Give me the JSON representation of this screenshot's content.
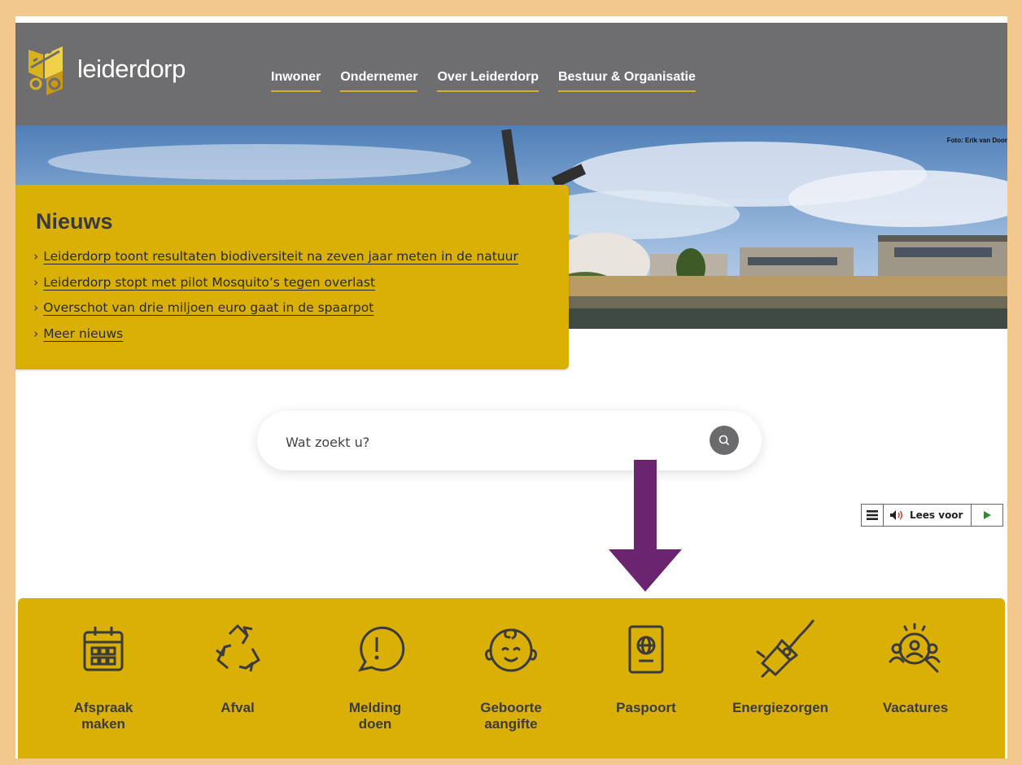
{
  "header": {
    "logo_text": "leiderdorp",
    "nav": [
      "Inwoner",
      "Ondernemer",
      "Over Leiderdorp",
      "Bestuur & Organisatie"
    ]
  },
  "hero": {
    "photo_credit": "Foto: Erik van Door"
  },
  "news": {
    "title": "Nieuws",
    "items": [
      "Leiderdorp toont resultaten biodiversiteit na zeven jaar meten in de natuur",
      "Leiderdorp stopt met pilot Mosquito’s tegen overlast",
      "Overschot van drie miljoen euro gaat in de spaarpot",
      "Meer nieuws"
    ]
  },
  "search": {
    "placeholder": "Wat zoekt u?"
  },
  "readspeaker": {
    "label": "Lees voor"
  },
  "tiles": [
    {
      "label": "Afspraak\nmaken",
      "icon": "calendar-icon"
    },
    {
      "label": "Afval",
      "icon": "recycle-icon"
    },
    {
      "label": "Melding\ndoen",
      "icon": "exclamation-bubble-icon"
    },
    {
      "label": "Geboorte\naangifte",
      "icon": "baby-face-icon"
    },
    {
      "label": "Paspoort",
      "icon": "passport-icon"
    },
    {
      "label": "Energiezorgen",
      "icon": "plug-icon"
    },
    {
      "label": "Vacatures",
      "icon": "job-search-icon"
    }
  ],
  "colors": {
    "header": "#6e6e71",
    "accent": "#dbb005",
    "arrow": "#6b2470",
    "frame": "#f3c88f"
  }
}
